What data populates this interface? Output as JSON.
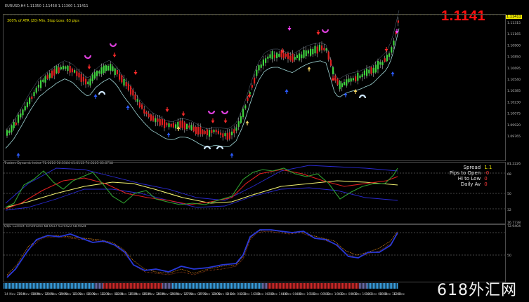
{
  "main_chart": {
    "title": "EURUSD,H4  1.11350 1.11458 1.11300 1.11411",
    "sub": "300% of ATR (20)      Min. Stop Loss:   63 pips",
    "big_price": "1.1141",
    "current_price_tag": "1.11411",
    "price_ticks": [
      "1.11315",
      "1.11165",
      "1.10900",
      "1.10850",
      "1.10695",
      "1.10540",
      "1.10385",
      "1.10230",
      "1.10075",
      "1.09920",
      "1.09765"
    ]
  },
  "tdi": {
    "title": "Traders Dynamic Index 71.0616 56.3364 41.0113 74.0105 63.6738",
    "scale": [
      "81.2226",
      "68",
      "50",
      "32",
      "16.7738"
    ],
    "hud": [
      {
        "label": "Spread",
        "value": "1.1",
        "color": "#e6e000"
      },
      {
        "label": "Pips to Open",
        "value": "-0",
        "color": "#ff3a3a"
      },
      {
        "label": "Hi to Low",
        "value": "0",
        "color": "#ff3a3a"
      },
      {
        "label": "Daily Av",
        "value": "0",
        "color": "#ff3a3a"
      }
    ]
  },
  "qqe": {
    "title": "QQE Current Timeframe 68.0937 63.9423 58.9424",
    "scale": [
      "72.9404",
      "50"
    ]
  },
  "time_axis": [
    "14 Nov 2019",
    "19 Nov 08:00",
    "18 Nov 16:00",
    "20 Nov 08:00",
    "20 Nov 16:00",
    "21 Nov 08:00",
    "21 Nov 16:00",
    "22 Nov 08:00",
    "22 Nov 16:00",
    "25 Nov 08:00",
    "25 Nov 16:00",
    "26 Nov 08:00",
    "26 Nov 16:00",
    "27 Nov 08:00",
    "27 Nov 16:00",
    "28 Nov 08:00",
    "2 Dec 08:00",
    "2 Dec 16:00",
    "3 Dec 08:00",
    "3 Dec 16:00",
    "4 Dec 08:00",
    "4 Dec 16:00",
    "5 Dec 08:00",
    "5 Dec 16:00",
    "6 Dec 08:00",
    "6 Dec 16:00",
    "10 Dec 08:00",
    "10 Dec 16:00",
    "12 Dec"
  ],
  "watermark": "618外汇网",
  "colors": {
    "bull": "#3fd33f",
    "bear": "#e02020",
    "band": "#9fd6d6",
    "tdi_green": "#2f9f2f",
    "tdi_red": "#e02020",
    "tdi_yellow": "#f0f070",
    "tdi_blue": "#2a2ad0",
    "qqe_blue": "#2838d8",
    "qqe_orange": "#e08a1a"
  }
}
